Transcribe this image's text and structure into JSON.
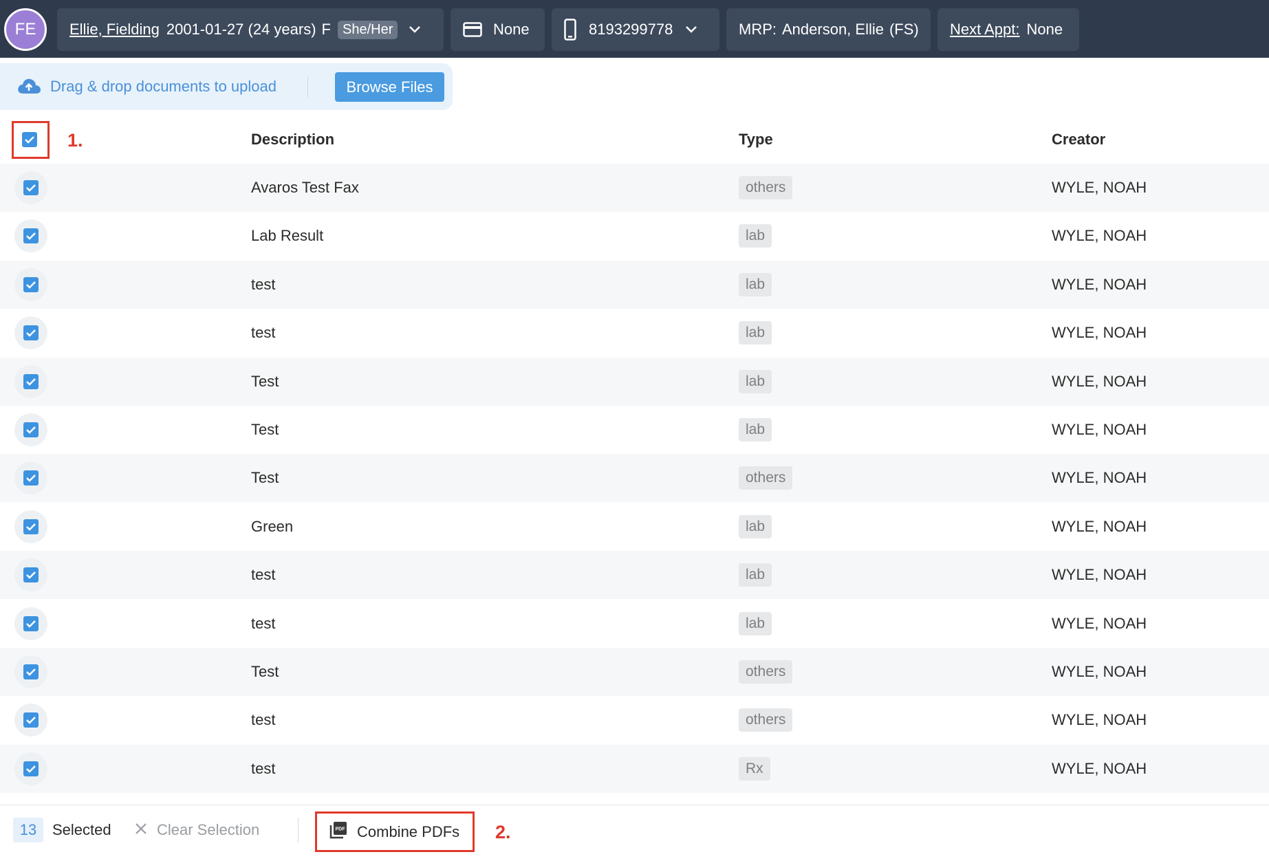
{
  "header": {
    "avatar_initials": "FE",
    "patient_name": "Ellie, Fielding",
    "patient_info": "2001-01-27 (24 years)",
    "sex": "F",
    "pronouns": "She/Her",
    "insurance": "None",
    "phone": "8193299778",
    "mrp_label": "MRP:",
    "mrp_value": "Anderson, Ellie",
    "mrp_suffix": "(FS)",
    "next_appt_label": "Next Appt:",
    "next_appt_value": "None"
  },
  "upload": {
    "drop_text": "Drag & drop documents to upload",
    "browse_label": "Browse Files"
  },
  "table": {
    "columns": {
      "description": "Description",
      "type": "Type",
      "creator": "Creator"
    },
    "rows": [
      {
        "description": "Avaros Test Fax",
        "type": "others",
        "creator": "WYLE, NOAH"
      },
      {
        "description": "Lab Result",
        "type": "lab",
        "creator": "WYLE, NOAH"
      },
      {
        "description": "test",
        "type": "lab",
        "creator": "WYLE, NOAH"
      },
      {
        "description": "test",
        "type": "lab",
        "creator": "WYLE, NOAH"
      },
      {
        "description": "Test",
        "type": "lab",
        "creator": "WYLE, NOAH"
      },
      {
        "description": "Test",
        "type": "lab",
        "creator": "WYLE, NOAH"
      },
      {
        "description": "Test",
        "type": "others",
        "creator": "WYLE, NOAH"
      },
      {
        "description": "Green",
        "type": "lab",
        "creator": "WYLE, NOAH"
      },
      {
        "description": "test",
        "type": "lab",
        "creator": "WYLE, NOAH"
      },
      {
        "description": "test",
        "type": "lab",
        "creator": "WYLE, NOAH"
      },
      {
        "description": "Test",
        "type": "others",
        "creator": "WYLE, NOAH"
      },
      {
        "description": "test",
        "type": "others",
        "creator": "WYLE, NOAH"
      },
      {
        "description": "test",
        "type": "Rx",
        "creator": "WYLE, NOAH"
      }
    ]
  },
  "annotations": {
    "step1": "1.",
    "step2": "2."
  },
  "footer": {
    "selected_count": "13",
    "selected_label": "Selected",
    "clear_label": "Clear Selection",
    "combine_label": "Combine PDFs"
  },
  "colors": {
    "header_bg": "#2f3b4c",
    "chip_bg": "#3d4a5c",
    "avatar": "#9b7fd6",
    "accent_blue": "#4a9be0",
    "checkbox": "#3d93e0",
    "annotation_red": "#e0392b"
  },
  "icons": {
    "upload": "cloud-upload-icon",
    "card": "credit-card-icon",
    "phone": "mobile-phone-icon",
    "dropdown": "chevron-down-icon",
    "clear": "close-icon",
    "combine": "pdf-stack-icon"
  }
}
